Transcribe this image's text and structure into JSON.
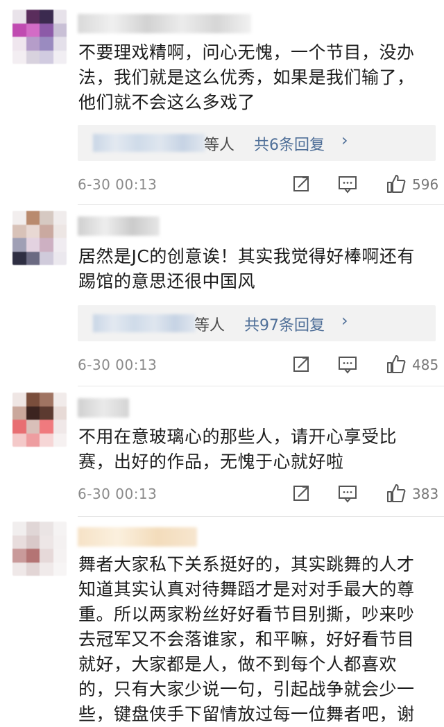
{
  "colors": {
    "link": "#4f6f98",
    "meta_gray": "#8a8a8a",
    "reply_bg": "#f2f2f2"
  },
  "comments": [
    {
      "text": "不要理戏精啊，问心无愧，一个节目，没办法，我们就是这么优秀，如果是我们输了，他们就不会这么多戏了",
      "reply_who": "等人",
      "reply_count": "共6条回复",
      "reply_chevron": "›",
      "time": "6-30  00:13",
      "likes": "596",
      "icons": [
        "share-icon",
        "comment-icon",
        "like-icon"
      ]
    },
    {
      "text": "居然是JC的创意诶！其实我觉得好棒啊还有踢馆的意思还很中国风",
      "reply_who": "等人",
      "reply_count": "共97条回复",
      "reply_chevron": "›",
      "time": "6-30  00:13",
      "likes": "485",
      "icons": [
        "share-icon",
        "comment-icon",
        "like-icon"
      ]
    },
    {
      "text": "不用在意玻璃心的那些人，请开心享受比赛，出好的作品，无愧于心就好啦",
      "time": "6-30  00:13",
      "likes": "383",
      "icons": [
        "share-icon",
        "comment-icon",
        "like-icon"
      ]
    },
    {
      "text": "舞者大家私下关系挺好的，其实跳舞的人才知道其实认真对待舞蹈才是对对手最大的尊重。所以两家粉丝好好看节目别撕，吵来吵去冠军又不会落谁家，和平嘛，好好看节目就好，大家都是人，做不到每个人都喜欢的，只有大家少说一句，引起战争就会少一些，键盘侠手下留情放过每一位舞者吧，谢"
    }
  ]
}
